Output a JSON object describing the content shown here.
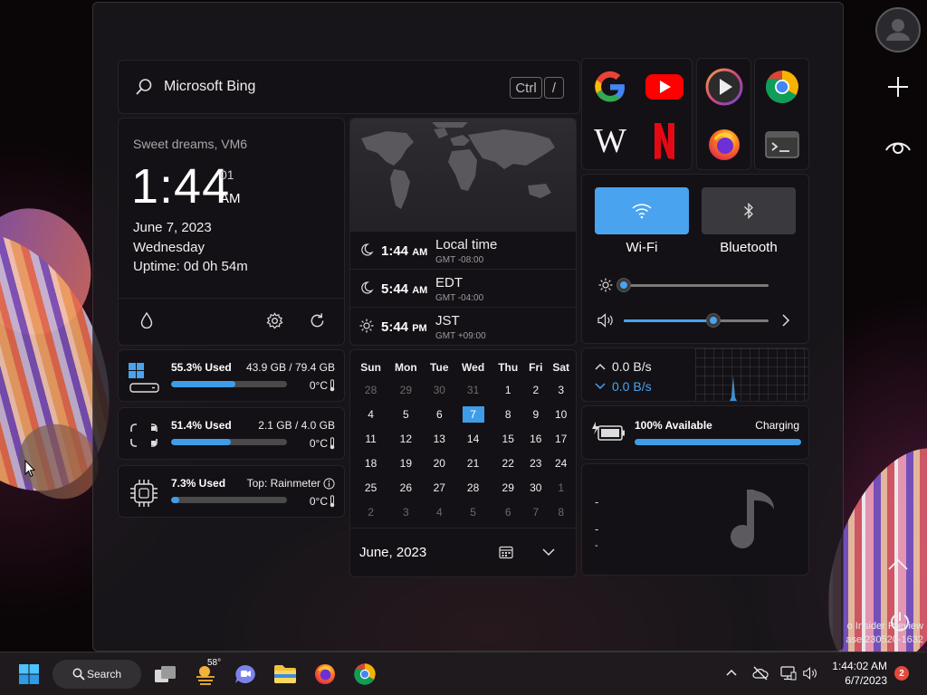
{
  "search": {
    "text": "Microsoft Bing",
    "key1": "Ctrl",
    "key2": "/"
  },
  "clock": {
    "greeting": "Sweet dreams, VM6",
    "time": "1:44",
    "seconds": "01",
    "ampm": "AM",
    "date": "June 7, 2023",
    "weekday": "Wednesday",
    "uptime": "Uptime: 0d 0h 54m"
  },
  "world": [
    {
      "time": "1:44",
      "ampm": "AM",
      "name": "Local time",
      "offset": "GMT -08:00"
    },
    {
      "time": "5:44",
      "ampm": "AM",
      "name": "EDT",
      "offset": "GMT -04:00"
    },
    {
      "time": "5:44",
      "ampm": "PM",
      "name": "JST",
      "offset": "GMT +09:00"
    }
  ],
  "quick": {
    "wifi": "Wi-Fi",
    "bluetooth": "Bluetooth",
    "brightness": 0,
    "volume": 0.62,
    "accent": "#4aa3ef"
  },
  "disk": {
    "used": "55.3% Used",
    "info": "43.9 GB / 79.4 GB",
    "temp": "0°C",
    "fill": 0.553
  },
  "ram": {
    "used": "51.4% Used",
    "info": "2.1 GB / 4.0 GB",
    "temp": "0°C",
    "fill": 0.514
  },
  "cpu": {
    "used": "7.3% Used",
    "info": "Top: Rainmeter",
    "temp": "0°C",
    "fill": 0.073
  },
  "calendar": {
    "days": [
      "Sun",
      "Mon",
      "Tue",
      "Wed",
      "Thu",
      "Fri",
      "Sat"
    ],
    "weeks": [
      [
        "28",
        "29",
        "30",
        "31",
        "1",
        "2",
        "3"
      ],
      [
        "4",
        "5",
        "6",
        "7",
        "8",
        "9",
        "10"
      ],
      [
        "11",
        "12",
        "13",
        "14",
        "15",
        "16",
        "17"
      ],
      [
        "18",
        "19",
        "20",
        "21",
        "22",
        "23",
        "24"
      ],
      [
        "25",
        "26",
        "27",
        "28",
        "29",
        "30",
        "1"
      ],
      [
        "2",
        "3",
        "4",
        "5",
        "6",
        "7",
        "8"
      ]
    ],
    "month": "June, 2023"
  },
  "network": {
    "upload": "0.0 B/s",
    "download": "0.0 B/s"
  },
  "battery": {
    "label": "100% Available",
    "status": "Charging",
    "fill": 1.0
  },
  "media": {
    "line1": "-",
    "line2": "-",
    "line3": "-"
  },
  "watermark": {
    "line1": "o Insider Preview",
    "line2": "ase.230520-1632"
  },
  "taskbar": {
    "search": "Search",
    "weather": "58°",
    "time": "1:44:02 AM",
    "date": "6/7/2023",
    "badge": "2"
  }
}
